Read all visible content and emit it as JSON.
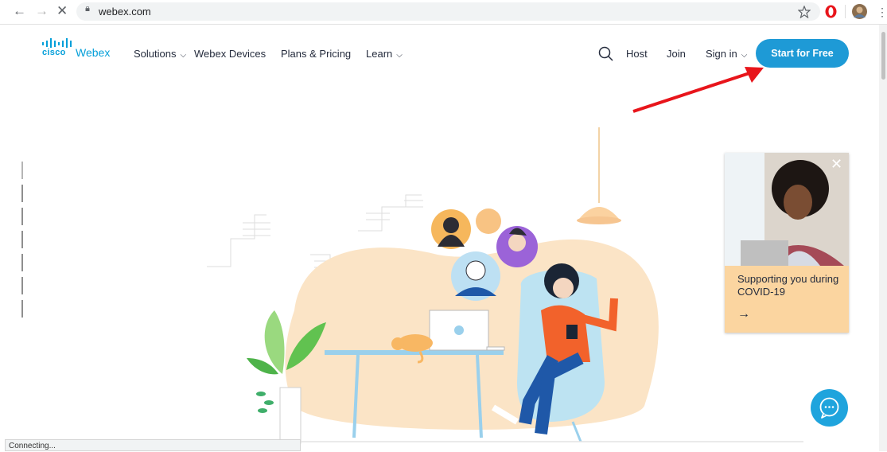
{
  "browser": {
    "url": "webex.com",
    "status_text": "Connecting..."
  },
  "header": {
    "logo_cisco": "cisco",
    "logo_webex": "Webex",
    "nav": [
      {
        "label": "Solutions",
        "has_dropdown": true
      },
      {
        "label": "Webex Devices",
        "has_dropdown": false
      },
      {
        "label": "Plans & Pricing",
        "has_dropdown": false
      },
      {
        "label": "Learn",
        "has_dropdown": true
      }
    ],
    "host": "Host",
    "join": "Join",
    "sign_in": "Sign in",
    "cta": "Start for Free"
  },
  "promo_card": {
    "text": "Supporting you during COVID-19",
    "arrow": "→",
    "close": "✕"
  },
  "colors": {
    "brand": "#049fd9",
    "cta": "#1e9ad6",
    "card_bg": "#fbd5a0",
    "annotation_arrow": "#e8151b"
  },
  "icons": [
    "back-icon",
    "forward-icon",
    "stop-icon",
    "lock-icon",
    "star-icon",
    "opera-icon",
    "profile-icon",
    "menu-icon",
    "search-icon",
    "chat-icon"
  ]
}
